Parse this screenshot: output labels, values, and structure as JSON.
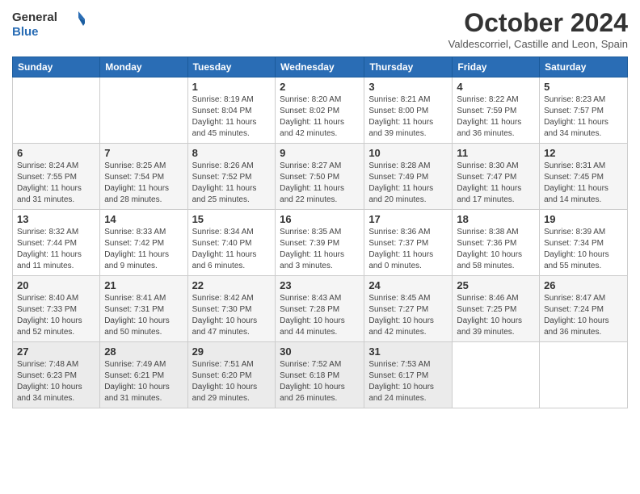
{
  "logo": {
    "line1": "General",
    "line2": "Blue"
  },
  "header": {
    "title": "October 2024",
    "subtitle": "Valdescorriel, Castille and Leon, Spain"
  },
  "weekdays": [
    "Sunday",
    "Monday",
    "Tuesday",
    "Wednesday",
    "Thursday",
    "Friday",
    "Saturday"
  ],
  "weeks": [
    [
      {
        "day": "",
        "info": ""
      },
      {
        "day": "",
        "info": ""
      },
      {
        "day": "1",
        "info": "Sunrise: 8:19 AM\nSunset: 8:04 PM\nDaylight: 11 hours and 45 minutes."
      },
      {
        "day": "2",
        "info": "Sunrise: 8:20 AM\nSunset: 8:02 PM\nDaylight: 11 hours and 42 minutes."
      },
      {
        "day": "3",
        "info": "Sunrise: 8:21 AM\nSunset: 8:00 PM\nDaylight: 11 hours and 39 minutes."
      },
      {
        "day": "4",
        "info": "Sunrise: 8:22 AM\nSunset: 7:59 PM\nDaylight: 11 hours and 36 minutes."
      },
      {
        "day": "5",
        "info": "Sunrise: 8:23 AM\nSunset: 7:57 PM\nDaylight: 11 hours and 34 minutes."
      }
    ],
    [
      {
        "day": "6",
        "info": "Sunrise: 8:24 AM\nSunset: 7:55 PM\nDaylight: 11 hours and 31 minutes."
      },
      {
        "day": "7",
        "info": "Sunrise: 8:25 AM\nSunset: 7:54 PM\nDaylight: 11 hours and 28 minutes."
      },
      {
        "day": "8",
        "info": "Sunrise: 8:26 AM\nSunset: 7:52 PM\nDaylight: 11 hours and 25 minutes."
      },
      {
        "day": "9",
        "info": "Sunrise: 8:27 AM\nSunset: 7:50 PM\nDaylight: 11 hours and 22 minutes."
      },
      {
        "day": "10",
        "info": "Sunrise: 8:28 AM\nSunset: 7:49 PM\nDaylight: 11 hours and 20 minutes."
      },
      {
        "day": "11",
        "info": "Sunrise: 8:30 AM\nSunset: 7:47 PM\nDaylight: 11 hours and 17 minutes."
      },
      {
        "day": "12",
        "info": "Sunrise: 8:31 AM\nSunset: 7:45 PM\nDaylight: 11 hours and 14 minutes."
      }
    ],
    [
      {
        "day": "13",
        "info": "Sunrise: 8:32 AM\nSunset: 7:44 PM\nDaylight: 11 hours and 11 minutes."
      },
      {
        "day": "14",
        "info": "Sunrise: 8:33 AM\nSunset: 7:42 PM\nDaylight: 11 hours and 9 minutes."
      },
      {
        "day": "15",
        "info": "Sunrise: 8:34 AM\nSunset: 7:40 PM\nDaylight: 11 hours and 6 minutes."
      },
      {
        "day": "16",
        "info": "Sunrise: 8:35 AM\nSunset: 7:39 PM\nDaylight: 11 hours and 3 minutes."
      },
      {
        "day": "17",
        "info": "Sunrise: 8:36 AM\nSunset: 7:37 PM\nDaylight: 11 hours and 0 minutes."
      },
      {
        "day": "18",
        "info": "Sunrise: 8:38 AM\nSunset: 7:36 PM\nDaylight: 10 hours and 58 minutes."
      },
      {
        "day": "19",
        "info": "Sunrise: 8:39 AM\nSunset: 7:34 PM\nDaylight: 10 hours and 55 minutes."
      }
    ],
    [
      {
        "day": "20",
        "info": "Sunrise: 8:40 AM\nSunset: 7:33 PM\nDaylight: 10 hours and 52 minutes."
      },
      {
        "day": "21",
        "info": "Sunrise: 8:41 AM\nSunset: 7:31 PM\nDaylight: 10 hours and 50 minutes."
      },
      {
        "day": "22",
        "info": "Sunrise: 8:42 AM\nSunset: 7:30 PM\nDaylight: 10 hours and 47 minutes."
      },
      {
        "day": "23",
        "info": "Sunrise: 8:43 AM\nSunset: 7:28 PM\nDaylight: 10 hours and 44 minutes."
      },
      {
        "day": "24",
        "info": "Sunrise: 8:45 AM\nSunset: 7:27 PM\nDaylight: 10 hours and 42 minutes."
      },
      {
        "day": "25",
        "info": "Sunrise: 8:46 AM\nSunset: 7:25 PM\nDaylight: 10 hours and 39 minutes."
      },
      {
        "day": "26",
        "info": "Sunrise: 8:47 AM\nSunset: 7:24 PM\nDaylight: 10 hours and 36 minutes."
      }
    ],
    [
      {
        "day": "27",
        "info": "Sunrise: 7:48 AM\nSunset: 6:23 PM\nDaylight: 10 hours and 34 minutes."
      },
      {
        "day": "28",
        "info": "Sunrise: 7:49 AM\nSunset: 6:21 PM\nDaylight: 10 hours and 31 minutes."
      },
      {
        "day": "29",
        "info": "Sunrise: 7:51 AM\nSunset: 6:20 PM\nDaylight: 10 hours and 29 minutes."
      },
      {
        "day": "30",
        "info": "Sunrise: 7:52 AM\nSunset: 6:18 PM\nDaylight: 10 hours and 26 minutes."
      },
      {
        "day": "31",
        "info": "Sunrise: 7:53 AM\nSunset: 6:17 PM\nDaylight: 10 hours and 24 minutes."
      },
      {
        "day": "",
        "info": ""
      },
      {
        "day": "",
        "info": ""
      }
    ]
  ]
}
